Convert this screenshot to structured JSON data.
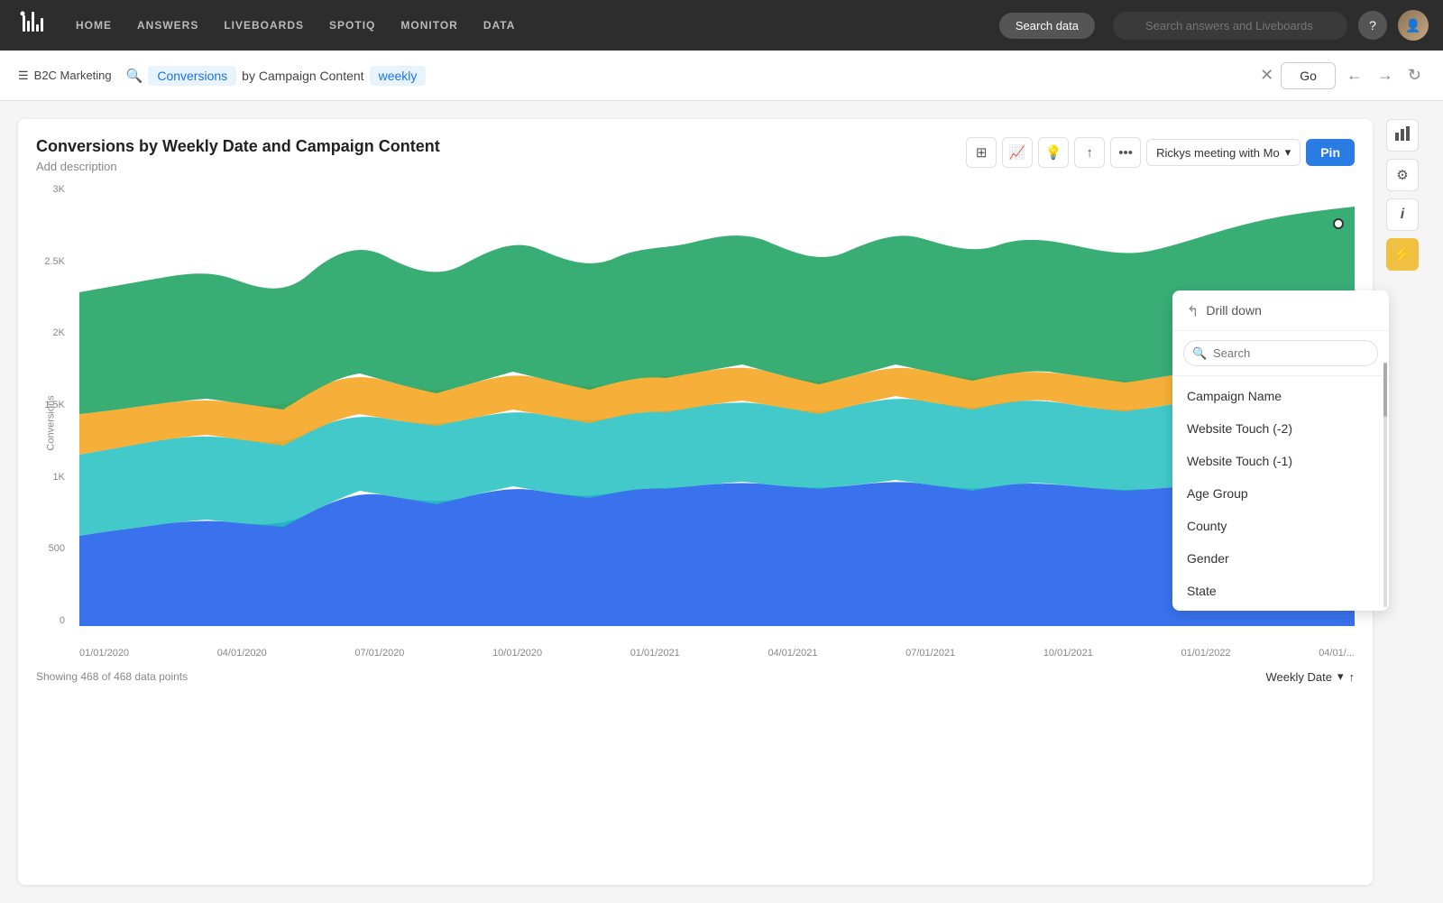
{
  "nav": {
    "logo": "T",
    "links": [
      "HOME",
      "ANSWERS",
      "LIVEBOARDS",
      "SPOTIQ",
      "MONITOR",
      "DATA"
    ],
    "search_data_label": "Search data",
    "global_search_placeholder": "Search answers and Liveboards",
    "help_icon": "?",
    "user_icon": "👤"
  },
  "breadcrumb": {
    "datasource": "B2C Marketing",
    "tag1": "Conversions",
    "tag2": "by Campaign Content",
    "tag3": "weekly",
    "go_label": "Go"
  },
  "chart": {
    "title": "Conversions by Weekly Date and Campaign Content",
    "subtitle": "Add description",
    "toolbar": {
      "pin_label": "Pin",
      "dropdown_label": "Rickys meeting with Mo"
    },
    "y_axis": {
      "label": "Conversions",
      "ticks": [
        "3K",
        "2.5K",
        "2K",
        "1.5K",
        "1K",
        "500",
        "0"
      ]
    },
    "x_axis": {
      "ticks": [
        "01/01/2020",
        "04/01/2020",
        "07/01/2020",
        "10/01/2020",
        "01/01/2021",
        "04/01/2021",
        "07/01/2021",
        "10/01/2021",
        "01/01/2022",
        "04/01/..."
      ]
    },
    "footer": {
      "data_points": "Showing 468 of 468 data points",
      "weekly_date_label": "Weekly Date"
    }
  },
  "drill_down": {
    "title": "Drill down",
    "search_placeholder": "Search",
    "items": [
      "Campaign Name",
      "Website Touch (-2)",
      "Website Touch (-1)",
      "Age Group",
      "County",
      "Gender",
      "State"
    ]
  },
  "sidebar": {
    "chart_icon": "📊",
    "settings_icon": "⚙",
    "info_icon": "ℹ",
    "lightning_icon": "⚡"
  }
}
